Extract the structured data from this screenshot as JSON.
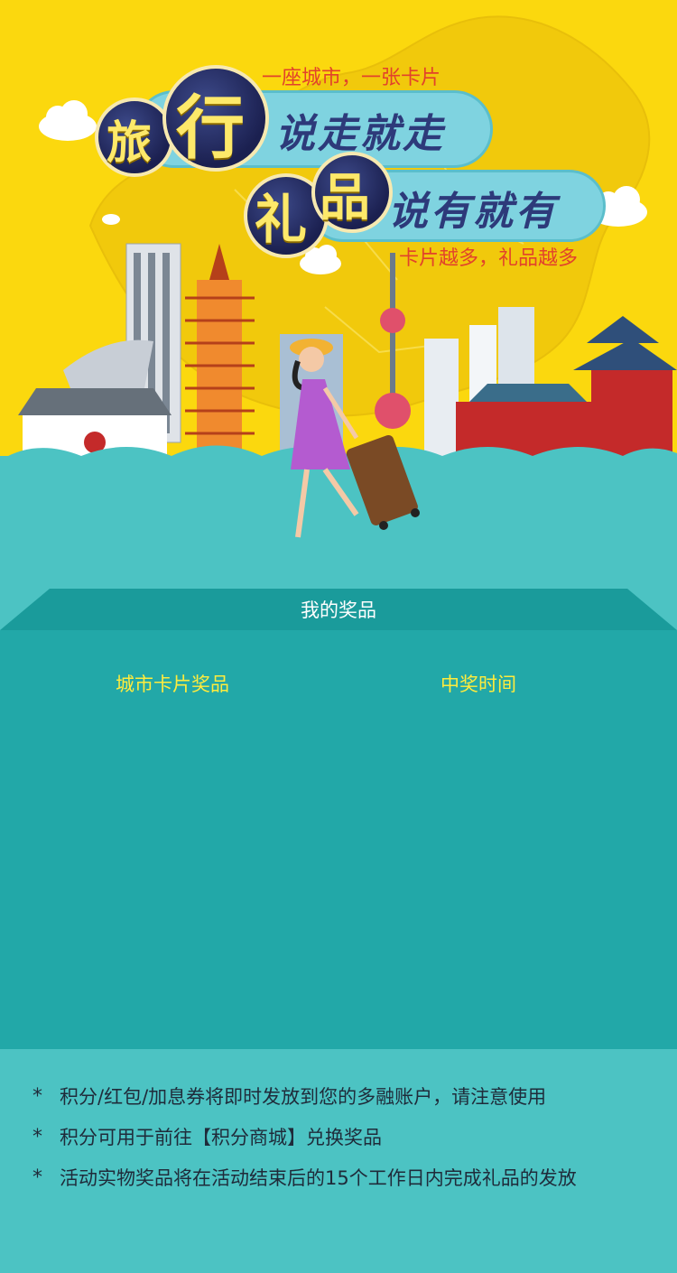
{
  "hero": {
    "tagline_top": "一座城市，一张卡片",
    "title1_char1": "旅",
    "title1_char2": "行",
    "title1_rest": "说走就走",
    "title2_char1": "礼",
    "title2_char2": "品",
    "title2_rest": "说有就有",
    "tagline_bottom": "卡片越多，礼品越多"
  },
  "prizes": {
    "section_title": "我的奖品",
    "col_card": "城市卡片奖品",
    "col_time": "中奖时间"
  },
  "notes": [
    {
      "star": "*",
      "text": "积分/红包/加息券将即时发放到您的多融账户，请注意使用"
    },
    {
      "star": "*",
      "text": "积分可用于前往【积分商城】兑换奖品"
    },
    {
      "star": "*",
      "text": "活动实物奖品将在活动结束后的15个工作日内完成礼品的发放"
    }
  ],
  "colors": {
    "hero_bg": "#fbd80e",
    "teal": "#4cc3c3",
    "panel": "#22a8a8",
    "accent_yellow": "#ffec3d",
    "tag_red": "#e2422b"
  }
}
